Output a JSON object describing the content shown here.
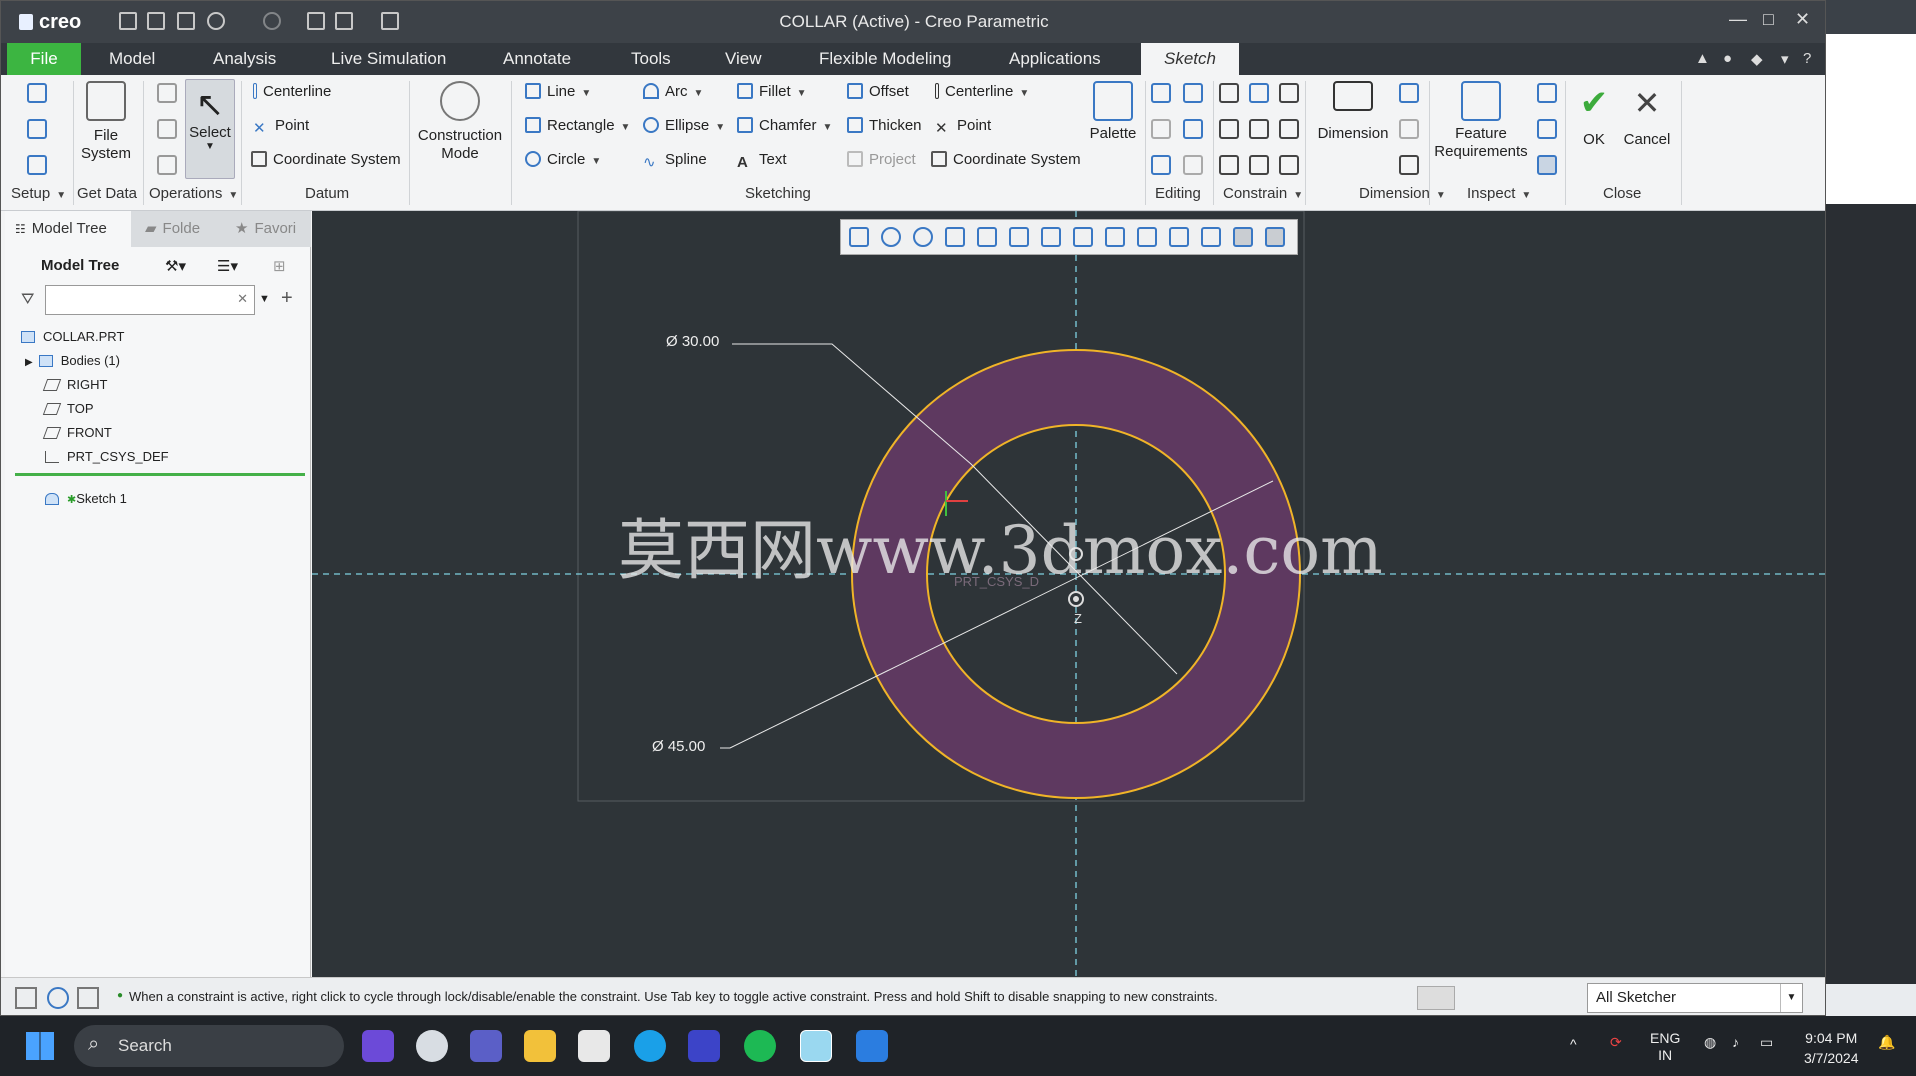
{
  "window": {
    "app_name": "creo",
    "title": "COLLAR (Active) - Creo Parametric"
  },
  "menu": [
    {
      "label": "File"
    },
    {
      "label": "Model"
    },
    {
      "label": "Analysis"
    },
    {
      "label": "Live Simulation"
    },
    {
      "label": "Annotate"
    },
    {
      "label": "Tools"
    },
    {
      "label": "View"
    },
    {
      "label": "Flexible Modeling"
    },
    {
      "label": "Applications"
    },
    {
      "label": "Sketch"
    }
  ],
  "ribbon": {
    "groups": {
      "setup": "Setup",
      "get_data": "Get Data",
      "operations": "Operations",
      "datum": "Datum",
      "sketching": "Sketching",
      "editing": "Editing",
      "constrain": "Constrain",
      "dimension": "Dimension",
      "inspect": "Inspect",
      "close": "Close"
    },
    "file_system": "File\nSystem",
    "select": "Select",
    "datum_items": [
      "Centerline",
      "Point",
      "Coordinate System"
    ],
    "construction_mode": "Construction\nMode",
    "sketch_col1": [
      "Line",
      "Rectangle",
      "Circle"
    ],
    "sketch_col2": [
      "Arc",
      "Ellipse",
      "Spline"
    ],
    "sketch_col3": [
      "Fillet",
      "Chamfer",
      "Text"
    ],
    "sketch_col4": [
      "Offset",
      "Thicken",
      "Project"
    ],
    "sketch_col5": [
      "Centerline",
      "Point",
      "Coordinate System"
    ],
    "palette": "Palette",
    "dimension_btn": "Dimension",
    "feature_requirements": "Feature\nRequirements",
    "ok": "OK",
    "cancel": "Cancel"
  },
  "left_panel": {
    "tabs": [
      "Model Tree",
      "Folde",
      "Favori"
    ],
    "header": "Model Tree",
    "search_placeholder": "",
    "tree": [
      "COLLAR.PRT",
      "Bodies (1)",
      "RIGHT",
      "TOP",
      "FRONT",
      "PRT_CSYS_DEF",
      "Sketch 1"
    ]
  },
  "canvas": {
    "dim_inner": "Ø 30.00",
    "dim_outer": "Ø 45.00",
    "csys_label": "PRT_CSYS_D",
    "axis_label": "Z",
    "watermark": "莫西网www.3dmox.com",
    "colors": {
      "ring_fill": "#5e3960",
      "circle_stroke": "#f0b428",
      "background": "#2e3438"
    }
  },
  "status": {
    "message": "When a constraint is active, right click to cycle through lock/disable/enable the constraint. Use Tab key to toggle active constraint. Press and hold Shift to disable snapping to new constraints.",
    "filter": "All Sketcher"
  },
  "taskbar": {
    "search": "Search",
    "lang": "ENG",
    "region": "IN",
    "time": "9:04 PM",
    "date": "3/7/2024"
  }
}
